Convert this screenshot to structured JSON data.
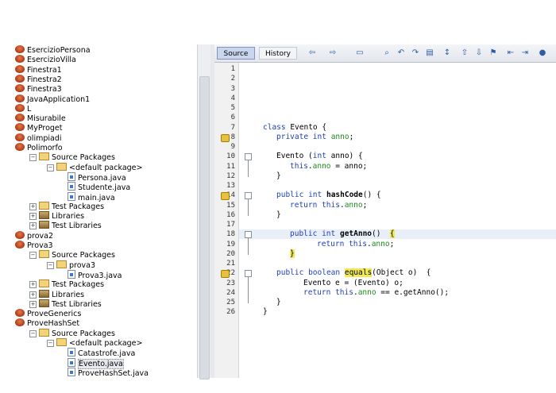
{
  "project_tree": [
    {
      "label": "EsercizioPersona",
      "kind": "project",
      "depth": 0
    },
    {
      "label": "EsercizioVilla",
      "kind": "project",
      "depth": 0
    },
    {
      "label": "Finestra1",
      "kind": "project",
      "depth": 0
    },
    {
      "label": "Finestra2",
      "kind": "project",
      "depth": 0
    },
    {
      "label": "Finestra3",
      "kind": "project",
      "depth": 0
    },
    {
      "label": "JavaApplication1",
      "kind": "project",
      "depth": 0
    },
    {
      "label": "L",
      "kind": "project",
      "depth": 0
    },
    {
      "label": "Misurabile",
      "kind": "project",
      "depth": 0
    },
    {
      "label": "MyProget",
      "kind": "project",
      "depth": 0
    },
    {
      "label": "olimpiadi",
      "kind": "project",
      "depth": 0
    },
    {
      "label": "Polimorfo",
      "kind": "project",
      "depth": 0
    },
    {
      "label": "Source Packages",
      "kind": "folder",
      "depth": 1,
      "expanded": true
    },
    {
      "label": "<default package>",
      "kind": "package",
      "depth": 2,
      "expanded": true
    },
    {
      "label": "Persona.java",
      "kind": "file",
      "depth": 3
    },
    {
      "label": "Studente.java",
      "kind": "file",
      "depth": 3
    },
    {
      "label": "main.java",
      "kind": "file",
      "depth": 3
    },
    {
      "label": "Test Packages",
      "kind": "folder",
      "depth": 1,
      "expanded": false
    },
    {
      "label": "Libraries",
      "kind": "library",
      "depth": 1,
      "expanded": false
    },
    {
      "label": "Test Libraries",
      "kind": "library",
      "depth": 1,
      "expanded": false
    },
    {
      "label": "prova2",
      "kind": "project",
      "depth": 0
    },
    {
      "label": "Prova3",
      "kind": "project",
      "depth": 0
    },
    {
      "label": "Source Packages",
      "kind": "folder",
      "depth": 1,
      "expanded": true
    },
    {
      "label": "prova3",
      "kind": "package",
      "depth": 2,
      "expanded": true
    },
    {
      "label": "Prova3.java",
      "kind": "file",
      "depth": 3
    },
    {
      "label": "Test Packages",
      "kind": "folder",
      "depth": 1,
      "expanded": false
    },
    {
      "label": "Libraries",
      "kind": "library",
      "depth": 1,
      "expanded": false
    },
    {
      "label": "Test Libraries",
      "kind": "library",
      "depth": 1,
      "expanded": false
    },
    {
      "label": "ProveGenerics",
      "kind": "project",
      "depth": 0
    },
    {
      "label": "ProveHashSet",
      "kind": "project",
      "depth": 0
    },
    {
      "label": "Source Packages",
      "kind": "folder",
      "depth": 1,
      "expanded": true
    },
    {
      "label": "<default package>",
      "kind": "package",
      "depth": 2,
      "expanded": true
    },
    {
      "label": "Catastrofe.java",
      "kind": "file",
      "depth": 3
    },
    {
      "label": "Evento.java",
      "kind": "file",
      "depth": 3,
      "selected": true
    },
    {
      "label": "ProveHashSet.java",
      "kind": "file",
      "depth": 3
    }
  ],
  "editor": {
    "tabs": {
      "source": "Source",
      "history": "History"
    },
    "line_numbers": [
      "1",
      "2",
      "3",
      "4",
      "5",
      "6",
      "7",
      "8",
      "9",
      "10",
      "11",
      "12",
      "13",
      "14",
      "15",
      "16",
      "17",
      "18",
      "19",
      "20",
      "21",
      "22",
      "23",
      "24",
      "25",
      "26"
    ],
    "code": {
      "l7": [
        "class",
        " Evento {"
      ],
      "l8": [
        "private",
        " ",
        "int",
        " ",
        "anno",
        ";"
      ],
      "l10": [
        "Evento (",
        "int",
        " anno) {"
      ],
      "l11": [
        "this",
        ".",
        "anno",
        " = anno;"
      ],
      "l12": [
        "}"
      ],
      "l14": [
        "public",
        " ",
        "int",
        " ",
        "hashCode",
        "() {"
      ],
      "l15": [
        "return",
        " ",
        "this",
        ".",
        "anno",
        ";"
      ],
      "l16": [
        "}"
      ],
      "l18": [
        "public",
        " ",
        "int",
        " ",
        "getAnno",
        "()  ",
        "{"
      ],
      "l19": [
        "return",
        " ",
        "this",
        ".",
        "anno",
        ";"
      ],
      "l20": [
        "}"
      ],
      "l22": [
        "public",
        " ",
        "boolean",
        " ",
        "equals",
        "(Object o)  {"
      ],
      "l23": [
        "Evento e = (Evento) o;"
      ],
      "l24": [
        "return",
        " ",
        "this",
        ".",
        "anno",
        " == e.getAnno();"
      ],
      "l25": [
        "}"
      ],
      "l26": [
        "}"
      ]
    }
  },
  "colors": {
    "keyword": "#1f3fb7",
    "field": "#1e8c1e",
    "highlight": "#f0ea5a",
    "current_line": "#e9eff9"
  }
}
